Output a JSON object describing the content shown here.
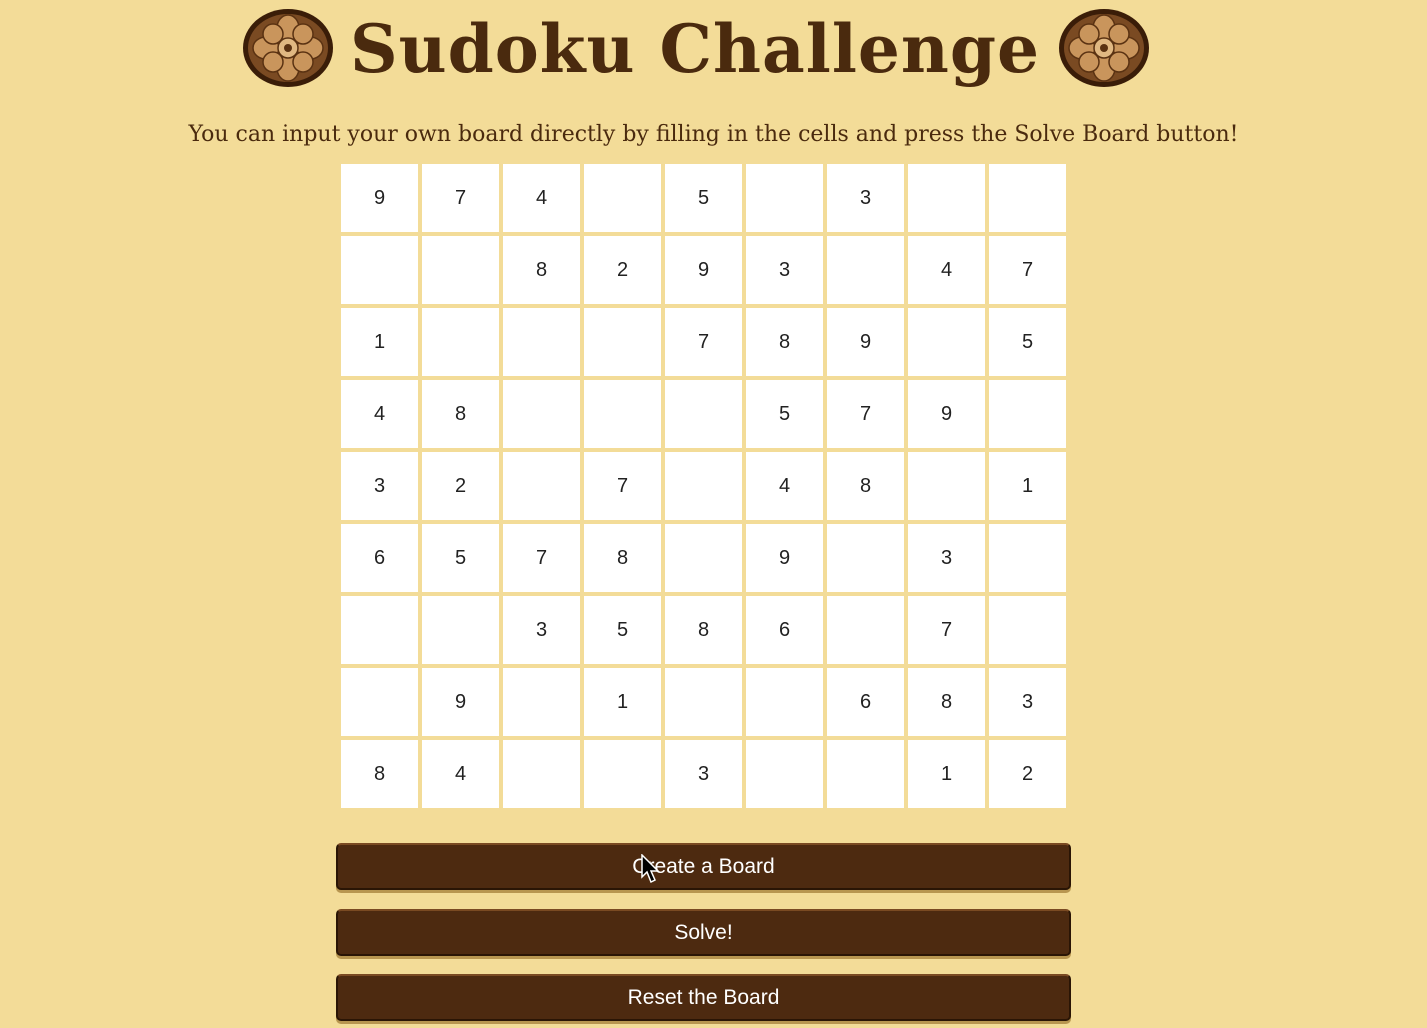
{
  "header": {
    "title": "Sudoku Challenge",
    "left_emblem_icon": "flower-emblem-icon",
    "right_emblem_icon": "flower-emblem-icon"
  },
  "instructions": "You can input your own board directly by filling in the cells and press the Solve Board button!",
  "board": {
    "rows": [
      [
        "9",
        "7",
        "4",
        "",
        "5",
        "",
        "3",
        "",
        ""
      ],
      [
        "",
        "",
        "8",
        "2",
        "9",
        "3",
        "",
        "4",
        "7"
      ],
      [
        "1",
        "",
        "",
        "",
        "7",
        "8",
        "9",
        "",
        "5"
      ],
      [
        "4",
        "8",
        "",
        "",
        "",
        "5",
        "7",
        "9",
        ""
      ],
      [
        "3",
        "2",
        "",
        "7",
        "",
        "4",
        "8",
        "",
        "1"
      ],
      [
        "6",
        "5",
        "7",
        "8",
        "",
        "9",
        "",
        "3",
        ""
      ],
      [
        "",
        "",
        "3",
        "5",
        "8",
        "6",
        "",
        "7",
        ""
      ],
      [
        "",
        "9",
        "",
        "1",
        "",
        "",
        "6",
        "8",
        "3"
      ],
      [
        "8",
        "4",
        "",
        "",
        "3",
        "",
        "",
        "1",
        "2"
      ]
    ]
  },
  "buttons": {
    "create_label": "Create a Board",
    "solve_label": "Solve!",
    "reset_label": "Reset the Board"
  },
  "colors": {
    "background": "#f3dc98",
    "title": "#4a2a0e",
    "button": "#4d2a10",
    "cell": "#ffffff"
  }
}
